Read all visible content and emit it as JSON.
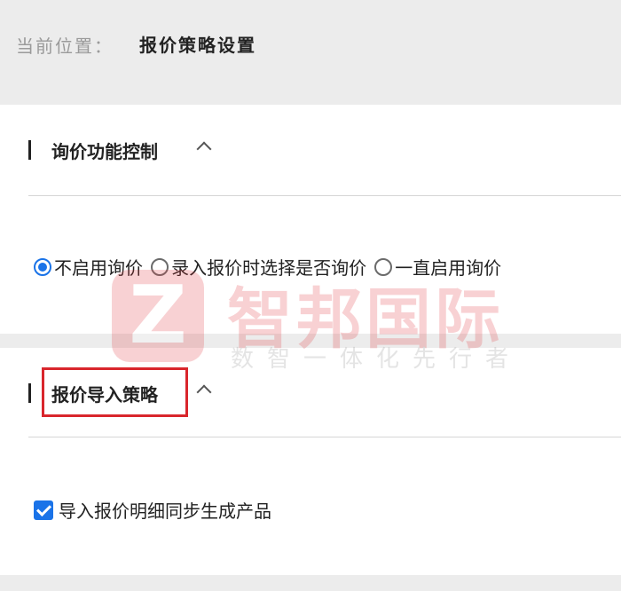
{
  "breadcrumb": {
    "prefix": "当前位置：",
    "current": "报价策略设置"
  },
  "inquiry_section": {
    "title": "询价功能控制",
    "options": [
      {
        "label": "不启用询价",
        "checked": true
      },
      {
        "label": "录入报价时选择是否询价",
        "checked": false
      },
      {
        "label": "一直启用询价",
        "checked": false
      }
    ]
  },
  "import_section": {
    "title": "报价导入策略",
    "checkbox_label": "导入报价明细同步生成产品",
    "checkbox_checked": true
  },
  "watermark": {
    "logo_letter": "Z",
    "brand": "智邦国际",
    "slogan": "数智一体化先行者"
  },
  "colors": {
    "accent": "#1a73e8",
    "highlight": "#d9262c",
    "watermark_red": "#e0343a"
  },
  "icons": {
    "collapse": "chevron-up-icon",
    "section_marker": "vertical-bar"
  }
}
